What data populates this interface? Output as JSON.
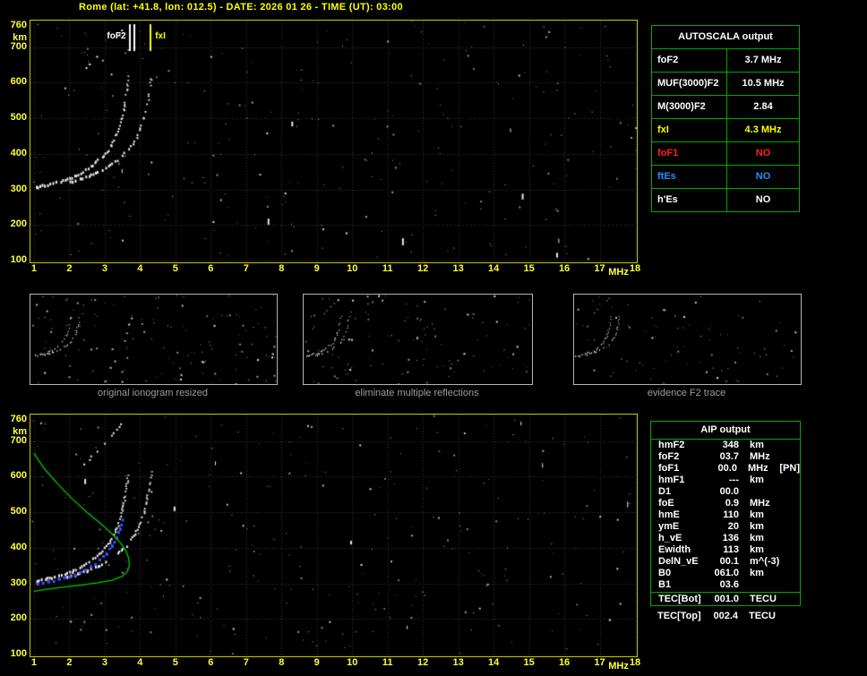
{
  "title": "Rome (lat: +41.8, lon: 012.5) - DATE: 2026 01 26 - TIME (UT): 03:00",
  "colors": {
    "background": "#000000",
    "title_yellow": "#ffff00",
    "axis_label_yellow": "#ffff40",
    "plot_border_yellow": "#c8c800",
    "grid_gray": "#3a3a3a",
    "table_border_green": "#00a800",
    "profile_green": "#00cc00",
    "restored_trace_blue": "#3753ff",
    "no_red": "#ff2020",
    "no_blue": "#2090ff",
    "white": "#ffffff",
    "caption_gray": "#9c9c9c"
  },
  "axes": {
    "x_ticks": [
      1,
      2,
      3,
      4,
      5,
      6,
      7,
      8,
      9,
      10,
      11,
      12,
      13,
      14,
      15,
      16,
      17,
      18
    ],
    "x_unit": "MHz",
    "y_ticks": [
      760,
      700,
      600,
      500,
      400,
      300,
      200,
      100
    ],
    "y_unit": "km"
  },
  "main_plot": {
    "markers": [
      {
        "label": "foF2",
        "f": 3.7,
        "color": "#ffffff",
        "side": "left"
      },
      {
        "label": "fxI",
        "f": 4.3,
        "color": "#ffff00",
        "side": "right"
      }
    ],
    "marker_lines": [
      {
        "f": 3.7,
        "color": "#ffffff"
      },
      {
        "f": 3.83,
        "color": "#ffffff"
      },
      {
        "f": 4.3,
        "color": "#ffff00"
      }
    ]
  },
  "thumbnails": [
    {
      "caption": "original ionogram resized"
    },
    {
      "caption": "eliminate multiple reflections"
    },
    {
      "caption": "evidence F2 trace"
    }
  ],
  "autoscala_table": {
    "header": "AUTOSCALA output",
    "rows": [
      {
        "label": "foF2",
        "value": "3.7 MHz",
        "color": "#ffffff"
      },
      {
        "label": "MUF(3000)F2",
        "value": "10.5 MHz",
        "color": "#ffffff"
      },
      {
        "label": "M(3000)F2",
        "value": "2.84",
        "color": "#ffffff"
      },
      {
        "label": "fxI",
        "value": "4.3 MHz",
        "color": "#ffff00"
      },
      {
        "label": "foF1",
        "value": "NO",
        "color": "#ff2020"
      },
      {
        "label": "ftEs",
        "value": "NO",
        "color": "#2090ff"
      },
      {
        "label": "h'Es",
        "value": "NO",
        "color": "#ffffff"
      }
    ]
  },
  "aip_table": {
    "header": "AIP output",
    "rows": [
      {
        "name": "hmF2",
        "value": "348",
        "unit": "km",
        "extra": ""
      },
      {
        "name": "foF2",
        "value": "03.7",
        "unit": "MHz",
        "extra": ""
      },
      {
        "name": "foF1",
        "value": "00.0",
        "unit": "MHz",
        "extra": "[PN]"
      },
      {
        "name": "hmF1",
        "value": "---",
        "unit": "km",
        "extra": ""
      },
      {
        "name": "D1",
        "value": "00.0",
        "unit": "",
        "extra": ""
      },
      {
        "name": "foE",
        "value": "0.9",
        "unit": "MHz",
        "extra": ""
      },
      {
        "name": "hmE",
        "value": "110",
        "unit": "km",
        "extra": ""
      },
      {
        "name": "ymE",
        "value": "20",
        "unit": "km",
        "extra": ""
      },
      {
        "name": "h_vE",
        "value": "136",
        "unit": "km",
        "extra": ""
      },
      {
        "name": "Ewidth",
        "value": "113",
        "unit": "km",
        "extra": ""
      },
      {
        "name": "DelN_vE",
        "value": "00.1",
        "unit": "m^(-3)",
        "extra": ""
      },
      {
        "name": "B0",
        "value": "061.0",
        "unit": "km",
        "extra": ""
      },
      {
        "name": "B1",
        "value": "03.6",
        "unit": "",
        "extra": ""
      }
    ],
    "tec_rows": [
      {
        "name": "TEC[Bot]",
        "value": "001.0",
        "unit": "TECU",
        "extra": ""
      },
      {
        "name": "TEC[Top]",
        "value": "002.4",
        "unit": "TECU",
        "extra": ""
      }
    ]
  },
  "chart_data": {
    "type": "scatter",
    "plots": [
      {
        "id": "main_ionogram",
        "xlabel": "MHz",
        "ylabel": "km",
        "xlim": [
          1,
          18
        ],
        "ylim": [
          100,
          760
        ],
        "grid": true
      },
      {
        "id": "processed_ionogram",
        "xlabel": "MHz",
        "ylabel": "km",
        "xlim": [
          1,
          18
        ],
        "ylim": [
          100,
          760
        ],
        "grid": true
      }
    ],
    "scaled_values": {
      "foF2_MHz": 3.7,
      "fxI_MHz": 4.3,
      "MUF3000F2_MHz": 10.5,
      "M3000F2": 2.84,
      "hmF2_km": 348,
      "foE_MHz": 0.9,
      "hmE_km": 110
    },
    "traces": {
      "f2_ordinary": [
        [
          1.05,
          305
        ],
        [
          1.5,
          315
        ],
        [
          2.0,
          330
        ],
        [
          2.4,
          350
        ],
        [
          2.7,
          372
        ],
        [
          2.95,
          395
        ],
        [
          3.15,
          420
        ],
        [
          3.3,
          450
        ],
        [
          3.45,
          490
        ],
        [
          3.55,
          540
        ],
        [
          3.62,
          590
        ],
        [
          3.66,
          625
        ]
      ],
      "f2_extraordinary": [
        [
          1.9,
          315
        ],
        [
          2.4,
          332
        ],
        [
          2.9,
          352
        ],
        [
          3.3,
          378
        ],
        [
          3.6,
          405
        ],
        [
          3.85,
          440
        ],
        [
          4.05,
          485
        ],
        [
          4.18,
          535
        ],
        [
          4.26,
          585
        ],
        [
          4.3,
          620
        ]
      ],
      "second_hop": [
        [
          2.4,
          635
        ],
        [
          3.6,
          760
        ]
      ],
      "electron_density_profile_green": [
        [
          1.0,
          666
        ],
        [
          1.3,
          622
        ],
        [
          1.7,
          577
        ],
        [
          2.1,
          536
        ],
        [
          2.5,
          500
        ],
        [
          2.9,
          467
        ],
        [
          3.2,
          440
        ],
        [
          3.45,
          414
        ],
        [
          3.6,
          392
        ],
        [
          3.68,
          371
        ],
        [
          3.7,
          350
        ],
        [
          3.64,
          333
        ],
        [
          3.5,
          320
        ],
        [
          3.2,
          309
        ],
        [
          2.8,
          302
        ],
        [
          2.3,
          295
        ],
        [
          1.8,
          289
        ],
        [
          1.4,
          284
        ],
        [
          1.0,
          278
        ]
      ],
      "restored_trace_blue": [
        [
          1.1,
          300
        ],
        [
          1.4,
          306
        ],
        [
          1.7,
          312
        ],
        [
          2.0,
          320
        ],
        [
          2.3,
          332
        ],
        [
          2.6,
          347
        ],
        [
          2.85,
          365
        ],
        [
          3.05,
          385
        ],
        [
          3.2,
          407
        ],
        [
          3.33,
          430
        ],
        [
          3.43,
          455
        ],
        [
          3.5,
          480
        ]
      ]
    }
  }
}
